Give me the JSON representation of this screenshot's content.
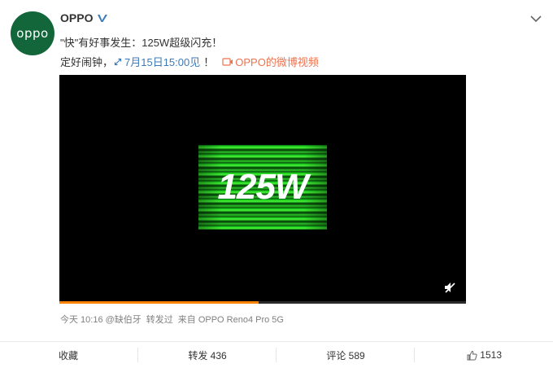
{
  "post": {
    "author": "OPPO",
    "avatar_text": "oppo",
    "line1": "\"快\"有好事发生：125W超级闪充！",
    "line2_prefix": "定好闹钟，",
    "event_link": "7月15日15:00见",
    "exclamation": "！",
    "video_link": "OPPO的微博视频"
  },
  "video": {
    "overlay_text": "125W",
    "progress_fraction": 0.49
  },
  "meta": {
    "time": "今天 10:16",
    "forwarder": "@缺伯牙",
    "repost_label": "转发过",
    "source": "来自 OPPO Reno4 Pro 5G"
  },
  "actions": {
    "favorite": "收藏",
    "repost": "转发 436",
    "comment": "评论 589",
    "like": "1513"
  },
  "icons": {
    "verified": "verified-badge-icon",
    "chevron": "chevron-down-icon",
    "clock": "clock-icon",
    "video": "video-icon",
    "mute": "mute-icon",
    "like": "thumbs-up-icon"
  },
  "colors": {
    "avatar_bg": "#13663a",
    "link_orange": "#eb7350",
    "link_blue": "#3f7ab8",
    "progress": "#ff8200",
    "verified": "#3f7ab8"
  }
}
